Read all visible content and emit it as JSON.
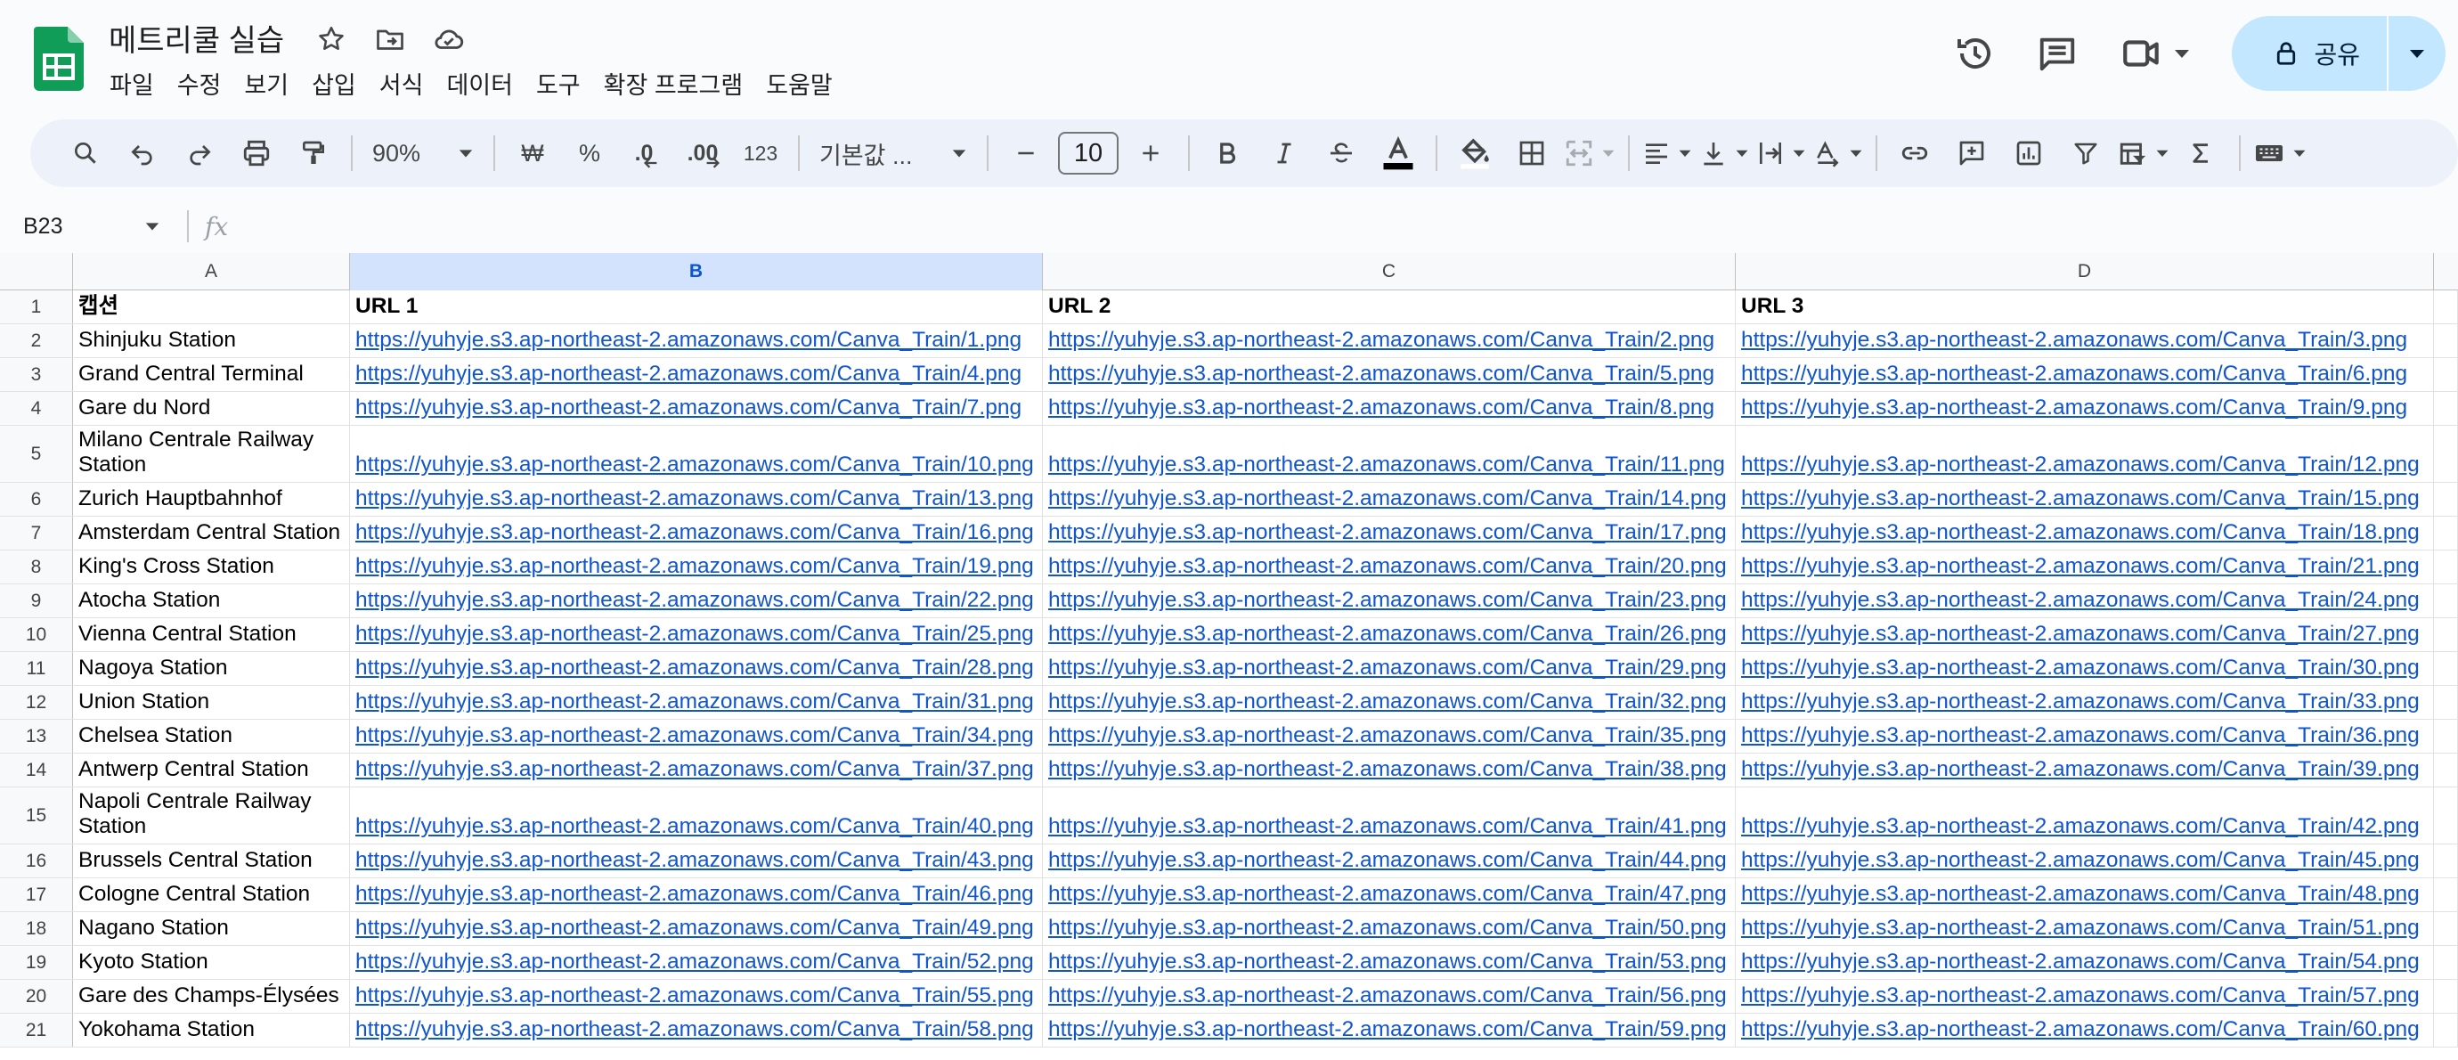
{
  "app": {
    "title": "메트리쿨 실습",
    "brand_color": "#0f9d58",
    "menu": [
      "파일",
      "수정",
      "보기",
      "삽입",
      "서식",
      "데이터",
      "도구",
      "확장 프로그램",
      "도움말"
    ],
    "share_label": "공유"
  },
  "toolbar": {
    "zoom": "90%",
    "currency": "₩",
    "percent": "%",
    "decimal_decrease": ".0",
    "decimal_increase": ".00",
    "number_format": "123",
    "font": "기본값 ...",
    "font_size": "10"
  },
  "formula_bar": {
    "cell_ref": "B23",
    "fx": "fx",
    "value": ""
  },
  "sheet": {
    "columns": [
      "A",
      "B",
      "C",
      "D"
    ],
    "selected_column": "B",
    "rows": [
      {
        "n": "1",
        "a": "캡션",
        "b": "URL 1",
        "c": "URL 2",
        "d": "URL 3"
      },
      {
        "n": "2",
        "a": "Shinjuku Station",
        "b": "https://yuhyje.s3.ap-northeast-2.amazonaws.com/Canva_Train/1.png",
        "c": "https://yuhyje.s3.ap-northeast-2.amazonaws.com/Canva_Train/2.png",
        "d": "https://yuhyje.s3.ap-northeast-2.amazonaws.com/Canva_Train/3.png"
      },
      {
        "n": "3",
        "a": "Grand Central Terminal",
        "b": "https://yuhyje.s3.ap-northeast-2.amazonaws.com/Canva_Train/4.png",
        "c": "https://yuhyje.s3.ap-northeast-2.amazonaws.com/Canva_Train/5.png",
        "d": "https://yuhyje.s3.ap-northeast-2.amazonaws.com/Canva_Train/6.png"
      },
      {
        "n": "4",
        "a": "Gare du Nord",
        "b": "https://yuhyje.s3.ap-northeast-2.amazonaws.com/Canva_Train/7.png",
        "c": "https://yuhyje.s3.ap-northeast-2.amazonaws.com/Canva_Train/8.png",
        "d": "https://yuhyje.s3.ap-northeast-2.amazonaws.com/Canva_Train/9.png"
      },
      {
        "n": "5",
        "a": "Milano Centrale Railway Station",
        "b": "https://yuhyje.s3.ap-northeast-2.amazonaws.com/Canva_Train/10.png",
        "c": "https://yuhyje.s3.ap-northeast-2.amazonaws.com/Canva_Train/11.png",
        "d": "https://yuhyje.s3.ap-northeast-2.amazonaws.com/Canva_Train/12.png"
      },
      {
        "n": "6",
        "a": "Zurich Hauptbahnhof",
        "b": "https://yuhyje.s3.ap-northeast-2.amazonaws.com/Canva_Train/13.png",
        "c": "https://yuhyje.s3.ap-northeast-2.amazonaws.com/Canva_Train/14.png",
        "d": "https://yuhyje.s3.ap-northeast-2.amazonaws.com/Canva_Train/15.png"
      },
      {
        "n": "7",
        "a": "Amsterdam Central Station",
        "b": "https://yuhyje.s3.ap-northeast-2.amazonaws.com/Canva_Train/16.png",
        "c": "https://yuhyje.s3.ap-northeast-2.amazonaws.com/Canva_Train/17.png",
        "d": "https://yuhyje.s3.ap-northeast-2.amazonaws.com/Canva_Train/18.png"
      },
      {
        "n": "8",
        "a": "King's Cross Station",
        "b": "https://yuhyje.s3.ap-northeast-2.amazonaws.com/Canva_Train/19.png",
        "c": "https://yuhyje.s3.ap-northeast-2.amazonaws.com/Canva_Train/20.png",
        "d": "https://yuhyje.s3.ap-northeast-2.amazonaws.com/Canva_Train/21.png"
      },
      {
        "n": "9",
        "a": "Atocha Station",
        "b": "https://yuhyje.s3.ap-northeast-2.amazonaws.com/Canva_Train/22.png",
        "c": "https://yuhyje.s3.ap-northeast-2.amazonaws.com/Canva_Train/23.png",
        "d": "https://yuhyje.s3.ap-northeast-2.amazonaws.com/Canva_Train/24.png"
      },
      {
        "n": "10",
        "a": "Vienna Central Station",
        "b": "https://yuhyje.s3.ap-northeast-2.amazonaws.com/Canva_Train/25.png",
        "c": "https://yuhyje.s3.ap-northeast-2.amazonaws.com/Canva_Train/26.png",
        "d": "https://yuhyje.s3.ap-northeast-2.amazonaws.com/Canva_Train/27.png"
      },
      {
        "n": "11",
        "a": "Nagoya Station",
        "b": "https://yuhyje.s3.ap-northeast-2.amazonaws.com/Canva_Train/28.png",
        "c": "https://yuhyje.s3.ap-northeast-2.amazonaws.com/Canva_Train/29.png",
        "d": "https://yuhyje.s3.ap-northeast-2.amazonaws.com/Canva_Train/30.png"
      },
      {
        "n": "12",
        "a": "Union Station",
        "b": "https://yuhyje.s3.ap-northeast-2.amazonaws.com/Canva_Train/31.png",
        "c": "https://yuhyje.s3.ap-northeast-2.amazonaws.com/Canva_Train/32.png",
        "d": "https://yuhyje.s3.ap-northeast-2.amazonaws.com/Canva_Train/33.png"
      },
      {
        "n": "13",
        "a": "Chelsea Station",
        "b": "https://yuhyje.s3.ap-northeast-2.amazonaws.com/Canva_Train/34.png",
        "c": "https://yuhyje.s3.ap-northeast-2.amazonaws.com/Canva_Train/35.png",
        "d": "https://yuhyje.s3.ap-northeast-2.amazonaws.com/Canva_Train/36.png"
      },
      {
        "n": "14",
        "a": "Antwerp Central Station",
        "b": "https://yuhyje.s3.ap-northeast-2.amazonaws.com/Canva_Train/37.png",
        "c": "https://yuhyje.s3.ap-northeast-2.amazonaws.com/Canva_Train/38.png",
        "d": "https://yuhyje.s3.ap-northeast-2.amazonaws.com/Canva_Train/39.png"
      },
      {
        "n": "15",
        "a": "Napoli Centrale Railway Station",
        "b": "https://yuhyje.s3.ap-northeast-2.amazonaws.com/Canva_Train/40.png",
        "c": "https://yuhyje.s3.ap-northeast-2.amazonaws.com/Canva_Train/41.png",
        "d": "https://yuhyje.s3.ap-northeast-2.amazonaws.com/Canva_Train/42.png"
      },
      {
        "n": "16",
        "a": "Brussels Central Station",
        "b": "https://yuhyje.s3.ap-northeast-2.amazonaws.com/Canva_Train/43.png",
        "c": "https://yuhyje.s3.ap-northeast-2.amazonaws.com/Canva_Train/44.png",
        "d": "https://yuhyje.s3.ap-northeast-2.amazonaws.com/Canva_Train/45.png"
      },
      {
        "n": "17",
        "a": "Cologne Central Station",
        "b": "https://yuhyje.s3.ap-northeast-2.amazonaws.com/Canva_Train/46.png",
        "c": "https://yuhyje.s3.ap-northeast-2.amazonaws.com/Canva_Train/47.png",
        "d": "https://yuhyje.s3.ap-northeast-2.amazonaws.com/Canva_Train/48.png"
      },
      {
        "n": "18",
        "a": "Nagano Station",
        "b": "https://yuhyje.s3.ap-northeast-2.amazonaws.com/Canva_Train/49.png",
        "c": "https://yuhyje.s3.ap-northeast-2.amazonaws.com/Canva_Train/50.png",
        "d": "https://yuhyje.s3.ap-northeast-2.amazonaws.com/Canva_Train/51.png"
      },
      {
        "n": "19",
        "a": "Kyoto Station",
        "b": "https://yuhyje.s3.ap-northeast-2.amazonaws.com/Canva_Train/52.png",
        "c": "https://yuhyje.s3.ap-northeast-2.amazonaws.com/Canva_Train/53.png",
        "d": "https://yuhyje.s3.ap-northeast-2.amazonaws.com/Canva_Train/54.png"
      },
      {
        "n": "20",
        "a": "Gare des Champs-Élysées",
        "b": "https://yuhyje.s3.ap-northeast-2.amazonaws.com/Canva_Train/55.png",
        "c": "https://yuhyje.s3.ap-northeast-2.amazonaws.com/Canva_Train/56.png",
        "d": "https://yuhyje.s3.ap-northeast-2.amazonaws.com/Canva_Train/57.png"
      },
      {
        "n": "21",
        "a": "Yokohama Station",
        "b": "https://yuhyje.s3.ap-northeast-2.amazonaws.com/Canva_Train/58.png",
        "c": "https://yuhyje.s3.ap-northeast-2.amazonaws.com/Canva_Train/59.png",
        "d": "https://yuhyje.s3.ap-northeast-2.amazonaws.com/Canva_Train/60.png"
      }
    ]
  }
}
